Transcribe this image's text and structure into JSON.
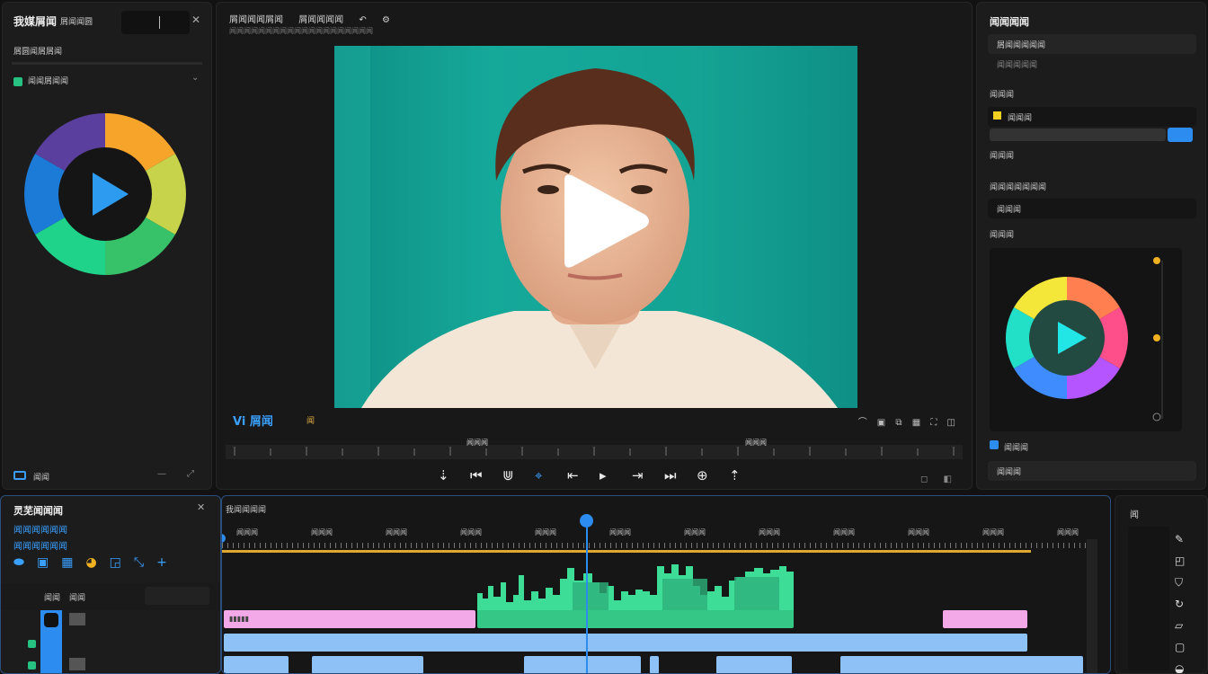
{
  "left_panel": {
    "title": "我媒屑闻",
    "subtitle": "屑闻闻圆",
    "row2": "屑圆闻屑屑闻",
    "section_label": "闻闻屑闻闻",
    "footer_label": "闻闻"
  },
  "viewer": {
    "top_labels": [
      "屑闻闻闻屑闻",
      "屑闻闻闻闻"
    ],
    "sub_label": "闻闻闻闻闻闻闻闻闻闻闻闻闻闻闻闻闻闻闻闻",
    "timecode": "Vi 屑闻",
    "timecode_secondary": "闻",
    "scrub_label_1": "闻闻闻",
    "scrub_label_2": "闻闻闻"
  },
  "right_panel": {
    "title": "闻闻闻闻",
    "rows": [
      "屑闻闻闻闻闻",
      "闻闻闻闻闻",
      "闻闻闻",
      "闻闻闻",
      "闻闻闻",
      "闻闻闻闻闻闻闻",
      "闻闻闻",
      "闻闻闻",
      "闻闻闻",
      "闻闻闻"
    ]
  },
  "timeline": {
    "panel_title": "灵芜闻闻闻",
    "header_label": "我闻闻闻闻",
    "left_rows": [
      "闻闻闻闻闻闻",
      "闻闻闻闻闻闻"
    ],
    "track_names": [
      "闻闻",
      "闻闻"
    ],
    "ruler": [
      "闻闻闻",
      "闻闻闻",
      "闻闻闻",
      "闻闻闻",
      "闻闻闻",
      "闻闻闻",
      "闻闻闻",
      "闻闻闻",
      "闻闻闻",
      "闻闻闻",
      "闻闻闻",
      "闻闻闻"
    ],
    "right_title": "闻"
  },
  "colors": {
    "accent": "#2d8cf0",
    "teal": "#15a99a",
    "pink_clip": "#f3a8e8",
    "blue_clip": "#8ec1f5",
    "audio": "#3ddc97"
  }
}
